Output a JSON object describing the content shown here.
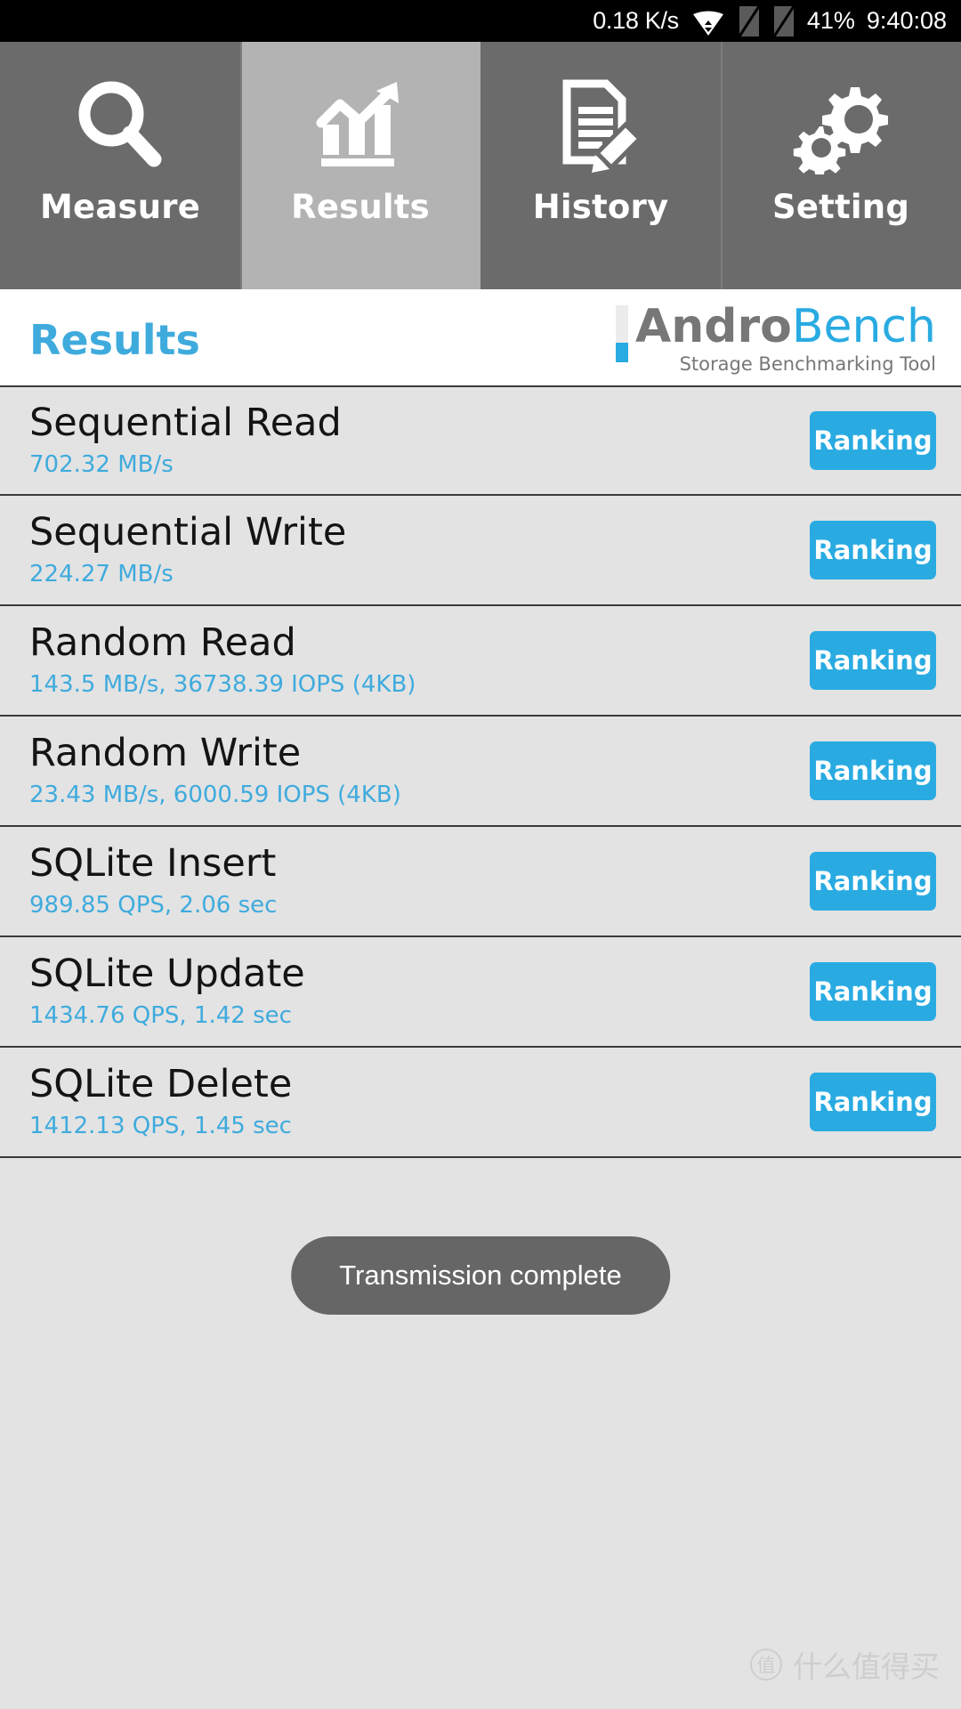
{
  "status_bar": {
    "network_speed": "0.18 K/s",
    "wifi_icon": "wifi-icon",
    "sim1_icon": "sim-card-slot-icon",
    "sim2_icon": "sim-card-slot-icon",
    "battery": "41%",
    "time": "9:40:08"
  },
  "tabs": [
    {
      "label": "Measure",
      "icon": "magnifier-icon",
      "active": false
    },
    {
      "label": "Results",
      "icon": "bar-chart-arrow-icon",
      "active": true
    },
    {
      "label": "History",
      "icon": "document-pencil-icon",
      "active": false
    },
    {
      "label": "Setting",
      "icon": "gears-icon",
      "active": false
    }
  ],
  "header": {
    "page_title": "Results",
    "logo_primary": "Andro",
    "logo_secondary": "Bench",
    "logo_subtitle": "Storage Benchmarking Tool"
  },
  "results": [
    {
      "title": "Sequential Read",
      "value": "702.32 MB/s",
      "button": "Ranking"
    },
    {
      "title": "Sequential Write",
      "value": "224.27 MB/s",
      "button": "Ranking"
    },
    {
      "title": "Random Read",
      "value": "143.5 MB/s, 36738.39 IOPS (4KB)",
      "button": "Ranking"
    },
    {
      "title": "Random Write",
      "value": "23.43 MB/s, 6000.59 IOPS (4KB)",
      "button": "Ranking"
    },
    {
      "title": "SQLite Insert",
      "value": "989.85 QPS, 2.06 sec",
      "button": "Ranking"
    },
    {
      "title": "SQLite Update",
      "value": "1434.76 QPS, 1.42 sec",
      "button": "Ranking"
    },
    {
      "title": "SQLite Delete",
      "value": "1412.13 QPS, 1.45 sec",
      "button": "Ranking"
    }
  ],
  "toast": {
    "message": "Transmission complete"
  },
  "watermark": {
    "badge": "值",
    "text": "什么值得买"
  },
  "colors": {
    "accent_blue": "#29abe2",
    "title_blue": "#3fabdd",
    "tab_inactive": "#6b6b6b",
    "tab_active": "#b3b3b3",
    "list_bg": "#e3e3e3",
    "divider": "#3a3a3a",
    "toast_bg": "#666666"
  }
}
